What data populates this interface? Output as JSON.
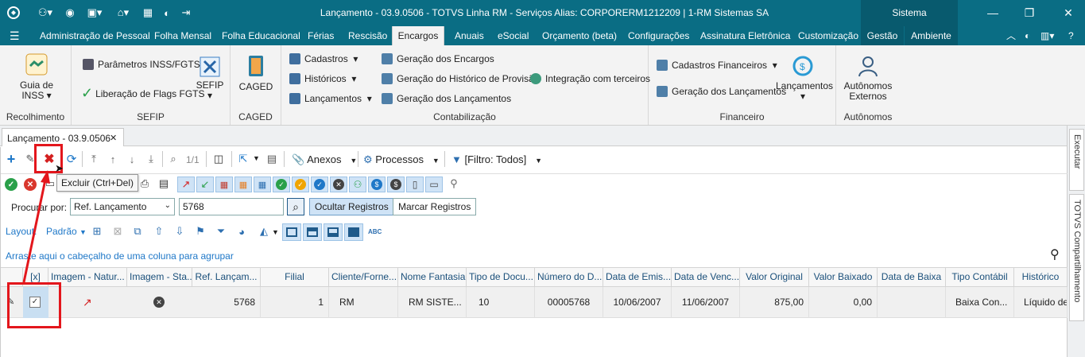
{
  "window": {
    "title": "Lançamento - 03.9.0506 - TOTVS Linha RM - Serviços  Alias: CORPORERM1212209 | 1-RM Sistemas SA",
    "sistema": "Sistema"
  },
  "menu": [
    "Administração de Pessoal",
    "Folha Mensal",
    "Folha Educacional",
    "Férias",
    "Rescisão",
    "Encargos",
    "Anuais",
    "eSocial",
    "Orçamento (beta)",
    "Configurações",
    "Assinatura Eletrônica",
    "Customização",
    "Gestão",
    "Ambiente"
  ],
  "menu_active": "Encargos",
  "ribbon": {
    "recolhimento": {
      "label": "Recolhimento",
      "guia": "Guia de",
      "guia2": "INSS"
    },
    "sefip": {
      "label": "SEFIP",
      "param": "Parâmetros INSS/FGTS",
      "liberacao": "Liberação de Flags FGTS",
      "sefip_btn": "SEFIP"
    },
    "caged": {
      "label": "CAGED",
      "btn": "CAGED"
    },
    "contabilizacao": {
      "label": "Contabilização",
      "cadastros": "Cadastros",
      "historicos": "Históricos",
      "lancamentos": "Lançamentos",
      "ger_encargos": "Geração dos Encargos",
      "ger_historico": "Geração do Histórico de Provisão",
      "ger_lancamentos": "Geração dos Lançamentos",
      "integracao": "Integração com terceiros"
    },
    "financeiro": {
      "label": "Financeiro",
      "cad_fin": "Cadastros Financeiros",
      "ger_lanc": "Geração dos Lançamentos",
      "lancamentos": "Lançamentos"
    },
    "autonomos": {
      "label": "Autônomos",
      "btn1": "Autônomos",
      "btn2": "Externos"
    }
  },
  "doctab": {
    "label": "Lançamento - 03.9.0506",
    "close": "✕"
  },
  "side": {
    "executar": "Executar",
    "compart": "TOTVS Compartilhamento"
  },
  "toolbar": {
    "page": "1/1",
    "anexos": "Anexos",
    "processos": "Processos",
    "filtro": "[Filtro: Todos]",
    "tooltip": "Excluir (Ctrl+Del)"
  },
  "search": {
    "label": "Procurar por:",
    "field": "Ref. Lançamento",
    "value": "5768",
    "ocultar": "Ocultar Registros",
    "marcar": "Marcar Registros"
  },
  "layout": {
    "label": "Layout:",
    "padrao": "Padrão"
  },
  "group_hint": "Arraste aqui o cabeçalho de uma coluna para agrupar",
  "columns": [
    "[x]",
    "Imagem - Natur...",
    "Imagem - Sta...",
    "Ref. Lançam...",
    "Filial",
    "Cliente/Forne...",
    "Nome Fantasia",
    "Tipo de Docu...",
    "Número do D...",
    "Data de Emis...",
    "Data de Venc...",
    "Valor Original",
    "Valor Baixado",
    "Data de Baixa",
    "Tipo Contábil",
    "Histórico"
  ],
  "row": {
    "ref": "5768",
    "filial": "1",
    "cliente": "RM",
    "fantasia": "RM SISTE...",
    "tipo": "10",
    "numero": "00005768",
    "emissao": "10/06/2007",
    "venc": "11/06/2007",
    "valor": "875,00",
    "baixado": "0,00",
    "baixa": "",
    "contabil": "Baixa Con...",
    "historico": "Líquido de..."
  },
  "colors": {
    "titlebar": "#0a6d84",
    "accent": "#e3161c"
  }
}
